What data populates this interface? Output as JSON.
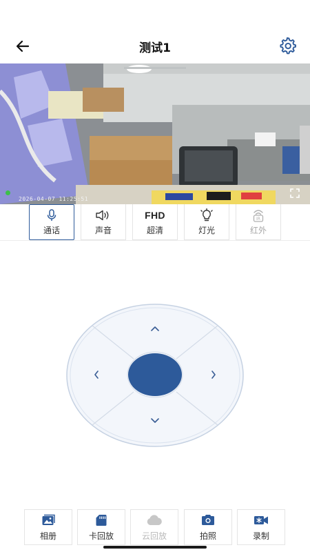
{
  "header": {
    "title": "测试1",
    "back_icon": "arrow-left-icon",
    "settings_icon": "gear-icon"
  },
  "video": {
    "timestamp": "2026-04-07 11:25:51"
  },
  "controls": [
    {
      "label": "通话",
      "icon": "microphone-icon",
      "active": true
    },
    {
      "label": "声音",
      "icon": "speaker-icon"
    },
    {
      "label": "超清",
      "icon_text": "FHD"
    },
    {
      "label": "灯光",
      "icon": "bulb-icon"
    },
    {
      "label": "红外",
      "icon": "infrared-icon",
      "disabled": true
    }
  ],
  "bottom": [
    {
      "label": "相册",
      "icon": "album-icon"
    },
    {
      "label": "卡回放",
      "icon": "sd-card-icon"
    },
    {
      "label": "云回放",
      "icon": "cloud-icon",
      "disabled": true
    },
    {
      "label": "拍照",
      "icon": "camera-icon"
    },
    {
      "label": "录制",
      "icon": "video-record-icon"
    }
  ],
  "colors": {
    "accent": "#2d5a9a",
    "disabled": "#b8b8b8"
  }
}
